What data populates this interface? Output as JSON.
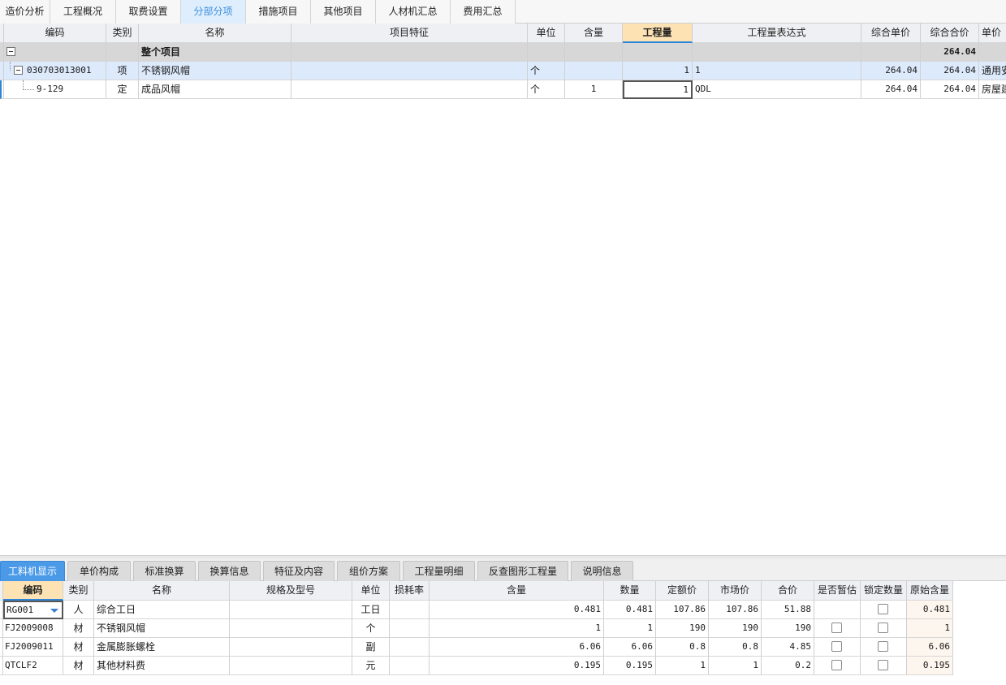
{
  "top_tabs": [
    "造价分析",
    "工程概况",
    "取费设置",
    "分部分项",
    "措施项目",
    "其他项目",
    "人材机汇总",
    "费用汇总"
  ],
  "top_active_tab": "分部分项",
  "main_grid": {
    "headers": [
      "编码",
      "类别",
      "名称",
      "项目特征",
      "单位",
      "含量",
      "工程量",
      "工程量表达式",
      "综合单价",
      "综合合价",
      "单价"
    ],
    "highlighted_header": "工程量",
    "summary_row": {
      "name": "整个项目",
      "total": "264.04"
    },
    "rows": [
      {
        "code": "030703013001",
        "type": "项",
        "name": "不锈钢风帽",
        "feature": "",
        "unit": "个",
        "ratio": "",
        "qty": "1",
        "expr": "1",
        "unit_price": "264.04",
        "total_price": "264.04",
        "price_kind": "通用安"
      },
      {
        "code": "9-129",
        "type": "定",
        "name": "成品风帽",
        "feature": "",
        "unit": "个",
        "ratio": "1",
        "qty": "1",
        "expr": "QDL",
        "unit_price": "264.04",
        "total_price": "264.04",
        "price_kind": "房屋建"
      }
    ]
  },
  "bottom_tabs": [
    "工料机显示",
    "单价构成",
    "标准换算",
    "换算信息",
    "特征及内容",
    "组价方案",
    "工程量明细",
    "反查图形工程量",
    "说明信息"
  ],
  "bottom_active_tab": "工料机显示",
  "detail_grid": {
    "headers": [
      "编码",
      "类别",
      "名称",
      "规格及型号",
      "单位",
      "损耗率",
      "含量",
      "数量",
      "定额价",
      "市场价",
      "合价",
      "是否暂估",
      "锁定数量",
      "原始含量"
    ],
    "highlighted_header": "编码",
    "rows": [
      {
        "code": "RG001",
        "type": "人",
        "name": "综合工日",
        "spec": "",
        "unit": "工日",
        "loss": "",
        "content": "0.481",
        "qty": "0.481",
        "quota_price": "107.86",
        "market_price": "107.86",
        "sum": "51.88",
        "provisional": false,
        "locked": false,
        "orig": "0.481",
        "has_provisional_box": false
      },
      {
        "code": "FJ2009008",
        "type": "材",
        "name": "不锈钢风帽",
        "spec": "",
        "unit": "个",
        "loss": "",
        "content": "1",
        "qty": "1",
        "quota_price": "190",
        "market_price": "190",
        "sum": "190",
        "provisional": false,
        "locked": false,
        "orig": "1",
        "has_provisional_box": true
      },
      {
        "code": "FJ2009011",
        "type": "材",
        "name": "金属膨胀螺栓",
        "spec": "",
        "unit": "副",
        "loss": "",
        "content": "6.06",
        "qty": "6.06",
        "quota_price": "0.8",
        "market_price": "0.8",
        "sum": "4.85",
        "provisional": false,
        "locked": false,
        "orig": "6.06",
        "has_provisional_box": true
      },
      {
        "code": "QTCLF2",
        "type": "材",
        "name": "其他材料费",
        "spec": "",
        "unit": "元",
        "loss": "",
        "content": "0.195",
        "qty": "0.195",
        "quota_price": "1",
        "market_price": "1",
        "sum": "0.2",
        "provisional": false,
        "locked": false,
        "orig": "0.195",
        "has_provisional_box": true
      }
    ]
  },
  "colors": {
    "accent": "#4a9ae8",
    "active_tab_text": "#3b8ee0",
    "header_highlight": "#fde3b4",
    "selected_row": "#ddeafc",
    "summary_row": "#d7d7d7"
  }
}
